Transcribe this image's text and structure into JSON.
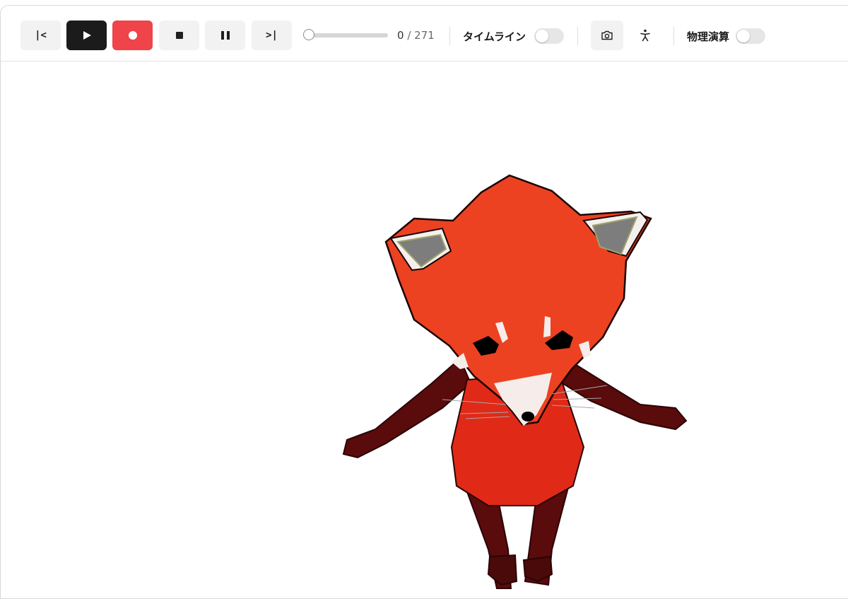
{
  "toolbar": {
    "first_label": "|<",
    "last_label": ">|",
    "frame_current": "0",
    "frame_total": "/ 271",
    "timeline_label": "タイムライン",
    "physics_label": "物理演算",
    "progress": 0
  },
  "toggles": {
    "timeline_on": false,
    "physics_on": false
  },
  "icons": [
    "play-icon",
    "record-icon",
    "stop-icon",
    "pause-icon",
    "camera-icon",
    "pose-icon"
  ],
  "colors": {
    "play_bg": "#1b1b1b",
    "record_bg": "#ee444a",
    "fox_fur": "#ec4221",
    "fox_limbs": "#5a0b0c"
  }
}
